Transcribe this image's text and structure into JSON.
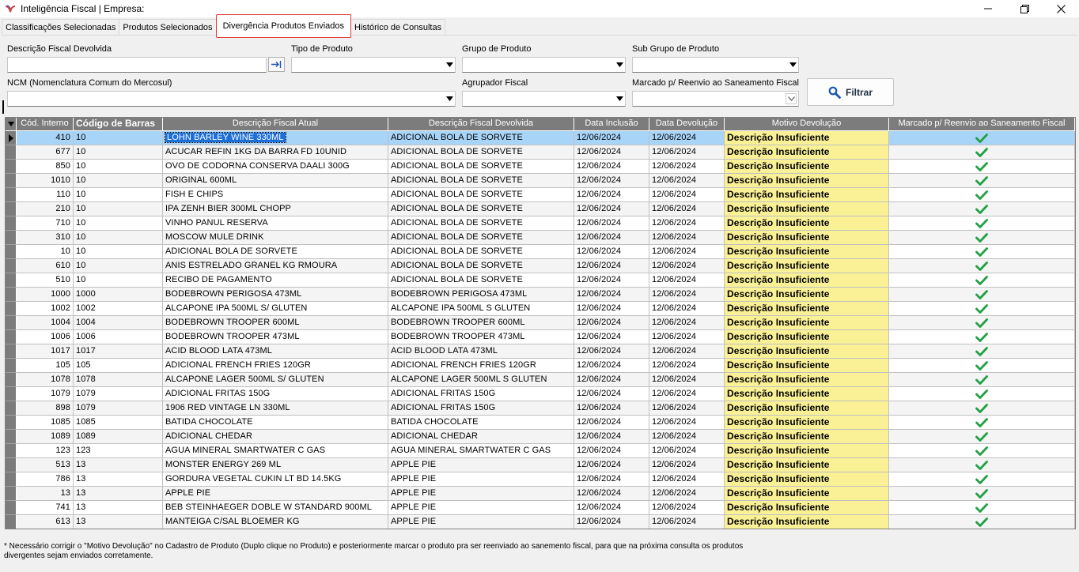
{
  "window": {
    "title": "Inteligência Fiscal | Empresa:",
    "minimize_icon": "minimize-icon",
    "maximize_icon": "restore-icon",
    "close_icon": "close-icon"
  },
  "tabs": [
    {
      "label": "Classificações Selecionadas",
      "active": false
    },
    {
      "label": "Produtos Selecionados",
      "active": false
    },
    {
      "label": "Divergência Produtos Enviados",
      "active": true
    },
    {
      "label": "Histórico de Consultas",
      "active": false
    }
  ],
  "filters": {
    "descricao_label": "Descrição Fiscal Devolvida",
    "descricao_value": "",
    "tipo_label": "Tipo de Produto",
    "tipo_value": "",
    "grupo_label": "Grupo de Produto",
    "grupo_value": "",
    "subgrupo_label": "Sub Grupo de Produto",
    "subgrupo_value": "",
    "ncm_label": "NCM (Nomenclatura Comum do Mercosul)",
    "ncm_value": "",
    "agrupador_label": "Agrupador Fiscal",
    "agrupador_value": "",
    "marcado_label": "Marcado p/ Reenvio ao Saneamento Fiscal",
    "marcado_value": "",
    "filter_button": "Filtrar"
  },
  "grid": {
    "columns": [
      "Cód. Interno",
      "Código de Barras",
      "Descrição Fiscal Atual",
      "Descrição Fiscal Devolvida",
      "Data Inclusão",
      "Data Devolução",
      "Motivo Devolução",
      "Marcado p/ Reenvio ao Saneamento Fiscal"
    ],
    "rows": [
      [
        "410",
        "10",
        "LOHN BARLEY WINE 330ML",
        "ADICIONAL BOLA DE SORVETE",
        "12/06/2024",
        "12/06/2024",
        "Descrição Insuficiente"
      ],
      [
        "677",
        "10",
        "ACUCAR REFIN 1KG DA BARRA FD 10UNID",
        "ADICIONAL BOLA DE SORVETE",
        "12/06/2024",
        "12/06/2024",
        "Descrição Insuficiente"
      ],
      [
        "850",
        "10",
        "OVO DE CODORNA CONSERVA DAALI 300G",
        "ADICIONAL BOLA DE SORVETE",
        "12/06/2024",
        "12/06/2024",
        "Descrição Insuficiente"
      ],
      [
        "1010",
        "10",
        "ORIGINAL 600ML",
        "ADICIONAL BOLA DE SORVETE",
        "12/06/2024",
        "12/06/2024",
        "Descrição Insuficiente"
      ],
      [
        "110",
        "10",
        "FISH E CHIPS",
        "ADICIONAL BOLA DE SORVETE",
        "12/06/2024",
        "12/06/2024",
        "Descrição Insuficiente"
      ],
      [
        "210",
        "10",
        "IPA ZENH BIER 300ML CHOPP",
        "ADICIONAL BOLA DE SORVETE",
        "12/06/2024",
        "12/06/2024",
        "Descrição Insuficiente"
      ],
      [
        "710",
        "10",
        "VINHO PANUL RESERVA",
        "ADICIONAL BOLA DE SORVETE",
        "12/06/2024",
        "12/06/2024",
        "Descrição Insuficiente"
      ],
      [
        "310",
        "10",
        "MOSCOW MULE DRINK",
        "ADICIONAL BOLA DE SORVETE",
        "12/06/2024",
        "12/06/2024",
        "Descrição Insuficiente"
      ],
      [
        "10",
        "10",
        "ADICIONAL BOLA DE SORVETE",
        "ADICIONAL BOLA DE SORVETE",
        "12/06/2024",
        "12/06/2024",
        "Descrição Insuficiente"
      ],
      [
        "610",
        "10",
        "ANIS ESTRELADO GRANEL KG RMOURA",
        "ADICIONAL BOLA DE SORVETE",
        "12/06/2024",
        "12/06/2024",
        "Descrição Insuficiente"
      ],
      [
        "510",
        "10",
        "RECIBO DE PAGAMENTO",
        "ADICIONAL BOLA DE SORVETE",
        "12/06/2024",
        "12/06/2024",
        "Descrição Insuficiente"
      ],
      [
        "1000",
        "1000",
        "BODEBROWN PERIGOSA 473ML",
        "BODEBROWN PERIGOSA 473ML",
        "12/06/2024",
        "12/06/2024",
        "Descrição Insuficiente"
      ],
      [
        "1002",
        "1002",
        "ALCAPONE IPA 500ML S/ GLUTEN",
        "ALCAPONE IPA 500ML S GLUTEN",
        "12/06/2024",
        "12/06/2024",
        "Descrição Insuficiente"
      ],
      [
        "1004",
        "1004",
        "BODEBROWN TROOPER 600ML",
        "BODEBROWN TROOPER 600ML",
        "12/06/2024",
        "12/06/2024",
        "Descrição Insuficiente"
      ],
      [
        "1006",
        "1006",
        "BODEBROWN TROOPER 473ML",
        "BODEBROWN TROOPER 473ML",
        "12/06/2024",
        "12/06/2024",
        "Descrição Insuficiente"
      ],
      [
        "1017",
        "1017",
        "ACID BLOOD LATA 473ML",
        "ACID BLOOD LATA 473ML",
        "12/06/2024",
        "12/06/2024",
        "Descrição Insuficiente"
      ],
      [
        "105",
        "105",
        "ADICIONAL FRENCH FRIES 120GR",
        "ADICIONAL FRENCH FRIES 120GR",
        "12/06/2024",
        "12/06/2024",
        "Descrição Insuficiente"
      ],
      [
        "1078",
        "1078",
        "ALCAPONE LAGER 500ML S/ GLUTEN",
        "ALCAPONE LAGER 500ML S GLUTEN",
        "12/06/2024",
        "12/06/2024",
        "Descrição Insuficiente"
      ],
      [
        "1079",
        "1079",
        "ADICIONAL FRITAS 150G",
        "ADICIONAL FRITAS 150G",
        "12/06/2024",
        "12/06/2024",
        "Descrição Insuficiente"
      ],
      [
        "898",
        "1079",
        "1906 RED VINTAGE LN 330ML",
        "ADICIONAL FRITAS 150G",
        "12/06/2024",
        "12/06/2024",
        "Descrição Insuficiente"
      ],
      [
        "1085",
        "1085",
        "BATIDA CHOCOLATE",
        "BATIDA CHOCOLATE",
        "12/06/2024",
        "12/06/2024",
        "Descrição Insuficiente"
      ],
      [
        "1089",
        "1089",
        "ADICIONAL CHEDAR",
        "ADICIONAL CHEDAR",
        "12/06/2024",
        "12/06/2024",
        "Descrição Insuficiente"
      ],
      [
        "123",
        "123",
        "AGUA MINERAL SMARTWATER C GAS",
        "AGUA MINERAL SMARTWATER C GAS",
        "12/06/2024",
        "12/06/2024",
        "Descrição Insuficiente"
      ],
      [
        "513",
        "13",
        "MONSTER ENERGY 269 ML",
        "APPLE PIE",
        "12/06/2024",
        "12/06/2024",
        "Descrição Insuficiente"
      ],
      [
        "786",
        "13",
        "GORDURA VEGETAL CUKIN LT BD 14.5KG",
        "APPLE PIE",
        "12/06/2024",
        "12/06/2024",
        "Descrição Insuficiente"
      ],
      [
        "13",
        "13",
        "APPLE PIE",
        "APPLE PIE",
        "12/06/2024",
        "12/06/2024",
        "Descrição Insuficiente"
      ],
      [
        "741",
        "13",
        "BEB STEINHAEGER DOBLE W STANDARD 900ML",
        "APPLE PIE",
        "12/06/2024",
        "12/06/2024",
        "Descrição Insuficiente"
      ],
      [
        "613",
        "13",
        "MANTEIGA C/SAL BLOEMER KG",
        "APPLE PIE",
        "12/06/2024",
        "12/06/2024",
        "Descrição Insuficiente"
      ]
    ],
    "check_icon": "check-icon",
    "check_color": "#22a045",
    "motivo_color": "#faf096",
    "selected_row": 0
  },
  "footer": {
    "note_line1": "* Necessário corrigir o \"Motivo Devolução\" no Cadastro de Produto (Duplo clique no Produto)  e posteriormente marcar o produto pra ser reenviado ao sanemento fiscal, para que na próxima consulta os produtos",
    "note_line2": "divergentes sejam enviados corretamente."
  }
}
